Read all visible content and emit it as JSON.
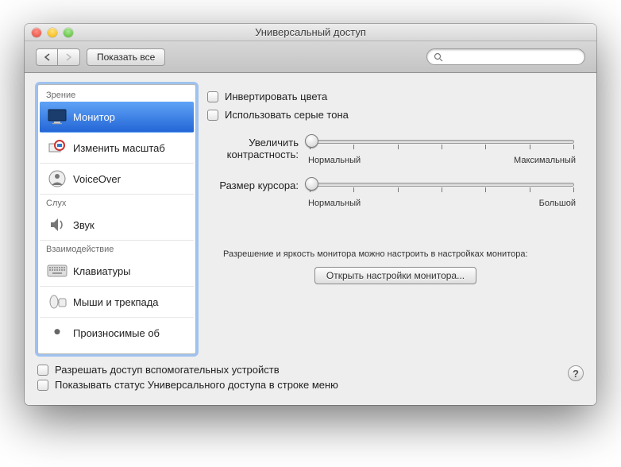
{
  "window": {
    "title": "Универсальный доступ"
  },
  "toolbar": {
    "show_all": "Показать все",
    "search_placeholder": ""
  },
  "sidebar": {
    "groups": [
      {
        "label": "Зрение"
      },
      {
        "label": "Слух"
      },
      {
        "label": "Взаимодействие"
      }
    ],
    "items": {
      "monitor": "Монитор",
      "zoom": "Изменить масштаб",
      "voiceover": "VoiceOver",
      "sound": "Звук",
      "keyboard": "Клавиатуры",
      "mouse": "Мыши и трекпада",
      "partial": "Произносимые об"
    }
  },
  "detail": {
    "invert": "Инвертировать цвета",
    "grayscale": "Использовать серые тона",
    "contrast_label": "Увеличить контрастность:",
    "contrast_min": "Нормальный",
    "contrast_max": "Максимальный",
    "cursor_label": "Размер курсора:",
    "cursor_min": "Нормальный",
    "cursor_max": "Большой",
    "note": "Разрешение и яркость монитора можно настроить в настройках монитора:",
    "open_display": "Открыть настройки монитора..."
  },
  "footer": {
    "assistive": "Разрешать доступ вспомогательных устройств",
    "menubar": "Показывать статус Универсального доступа в строке меню"
  }
}
